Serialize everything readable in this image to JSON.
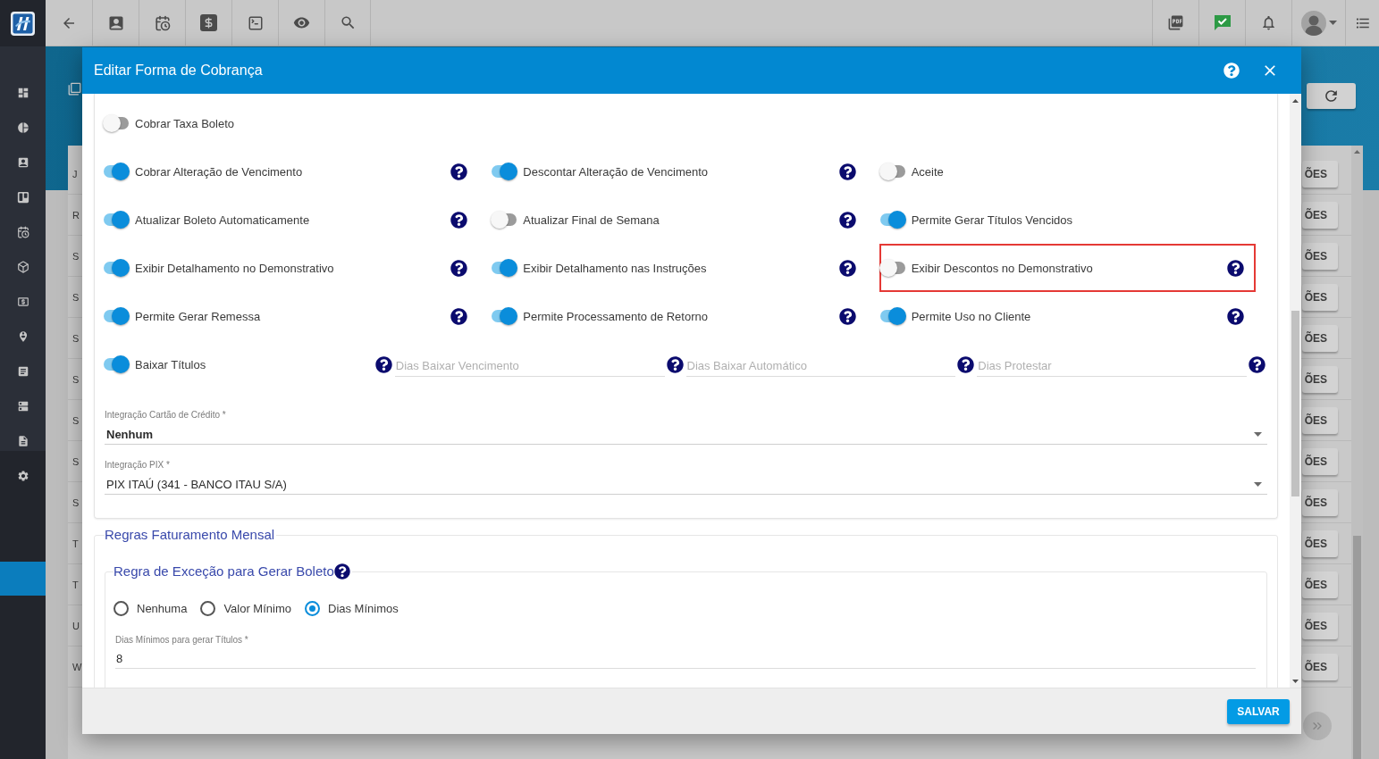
{
  "sidebar": {
    "items": [
      {
        "selected": false
      },
      {
        "selected": false
      },
      {
        "selected": false
      },
      {
        "selected": false
      },
      {
        "selected": false
      },
      {
        "selected": false
      },
      {
        "selected": false
      },
      {
        "selected": false
      },
      {
        "selected": false
      },
      {
        "selected": false
      },
      {
        "selected": false
      },
      {
        "selected": false
      }
    ],
    "highlight_bar": true
  },
  "background_table": {
    "rows": [
      {
        "column_1": "J",
        "action": "ÕES"
      },
      {
        "column_1": "R",
        "action": "ÕES"
      },
      {
        "column_1": "S",
        "action": "ÕES"
      },
      {
        "column_1": "S",
        "action": "ÕES"
      },
      {
        "column_1": "S",
        "action": "ÕES"
      },
      {
        "column_1": "S",
        "action": "ÕES"
      },
      {
        "column_1": "S",
        "action": "ÕES"
      },
      {
        "column_1": "S",
        "action": "ÕES"
      },
      {
        "column_1": "S",
        "action": "ÕES"
      },
      {
        "column_1": "T",
        "action": "ÕES"
      },
      {
        "column_1": "T",
        "action": "ÕES"
      },
      {
        "column_1": "U",
        "action": "ÕES"
      },
      {
        "column_1": "W",
        "action": "ÕES"
      }
    ]
  },
  "dialog": {
    "title": "Editar Forma de Cobrança",
    "top_toggles": [
      {
        "label": "Cobrar Taxa Boleto",
        "on": false,
        "help": false,
        "highlighted": false
      }
    ],
    "toggle_grid": [
      {
        "label": "Cobrar Alteração de Vencimento",
        "on": true,
        "help": true,
        "highlighted": false
      },
      {
        "label": "Descontar Alteração de Vencimento",
        "on": true,
        "help": true,
        "highlighted": false
      },
      {
        "label": "Aceite",
        "on": false,
        "help": false,
        "highlighted": false
      },
      {
        "label": "Atualizar Boleto Automaticamente",
        "on": true,
        "help": true,
        "highlighted": false
      },
      {
        "label": "Atualizar Final de Semana",
        "on": false,
        "help": true,
        "highlighted": false
      },
      {
        "label": "Permite Gerar Títulos Vencidos",
        "on": true,
        "help": false,
        "highlighted": false
      },
      {
        "label": "Exibir Detalhamento no Demonstrativo",
        "on": true,
        "help": true,
        "highlighted": false
      },
      {
        "label": "Exibir Detalhamento nas Instruções",
        "on": true,
        "help": true,
        "highlighted": false
      },
      {
        "label": "Exibir Descontos no Demonstrativo",
        "on": false,
        "help": true,
        "highlighted": true
      },
      {
        "label": "Permite Gerar Remessa",
        "on": true,
        "help": true,
        "highlighted": false
      },
      {
        "label": "Permite Processamento de Retorno",
        "on": true,
        "help": true,
        "highlighted": false
      },
      {
        "label": "Permite Uso no Cliente",
        "on": true,
        "help": true,
        "highlighted": false
      }
    ],
    "days_row": {
      "toggle": {
        "label": "Baixar Títulos",
        "on": true,
        "help": true
      },
      "fields": [
        {
          "placeholder": "Dias Baixar Vencimento",
          "help": true
        },
        {
          "placeholder": "Dias Baixar Automático",
          "help": true
        },
        {
          "placeholder": "Dias Protestar",
          "help": true
        }
      ]
    },
    "selects": [
      {
        "label": "Integração Cartão de Crédito *",
        "value": "Nenhum",
        "bold": true
      },
      {
        "label": "Integração PIX *",
        "value": "PIX ITAÚ (341 - BANCO ITAU S/A)",
        "bold": false
      }
    ],
    "billing_rules": {
      "legend": "Regras Faturamento Mensal",
      "exception_rule": {
        "legend": "Regra de Exceção para Gerar Boleto",
        "help": true,
        "options": [
          {
            "label": "Nenhuma",
            "selected": false
          },
          {
            "label": "Valor Mínimo",
            "selected": false
          },
          {
            "label": "Dias Mínimos",
            "selected": true
          }
        ],
        "field": {
          "label": "Dias Mínimos para gerar Títulos *",
          "value": "8"
        }
      }
    },
    "save_button": "SALVAR"
  }
}
